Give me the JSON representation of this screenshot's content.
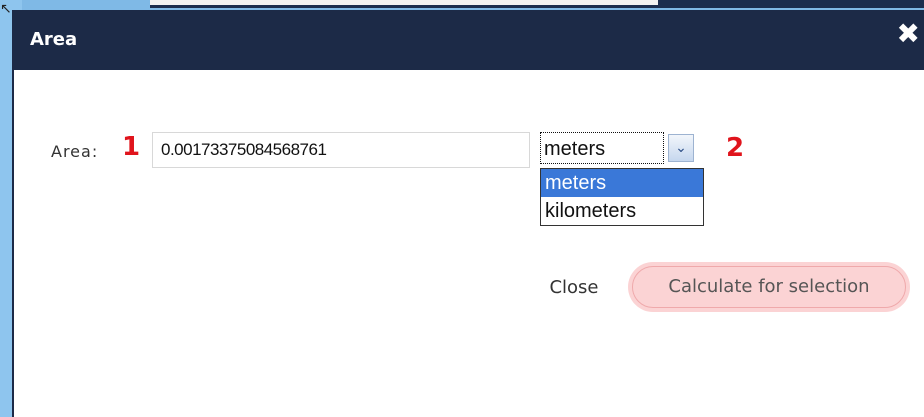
{
  "dialog": {
    "title": "Area",
    "close_icon_glyph": "✖"
  },
  "form": {
    "area_label": "Area:",
    "area_value": "0.00173375084568761",
    "marker_1": "1",
    "marker_2": "2",
    "unit_select": {
      "selected": "meters",
      "arrow_glyph": "⌄",
      "options": [
        "meters",
        "kilometers"
      ]
    }
  },
  "buttons": {
    "close_label": "Close",
    "calculate_label": "Calculate for selection"
  },
  "colors": {
    "titlebar": "#1c2a47",
    "marker_red": "#e0141c",
    "option_highlight": "#3a78d8",
    "calculate_button_bg": "#fbd3d4"
  },
  "icons": {
    "close": "close-icon",
    "dropdown_arrow": "chevron-down-icon",
    "cursor": "mouse-cursor-icon"
  }
}
